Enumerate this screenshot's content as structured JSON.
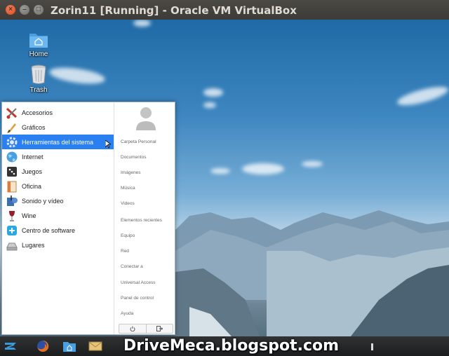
{
  "window": {
    "title": "Zorin11 [Running] - Oracle VM VirtualBox"
  },
  "desktop": {
    "icons": [
      {
        "label": "Home",
        "icon": "folder-home-icon"
      },
      {
        "label": "Trash",
        "icon": "trash-icon"
      }
    ]
  },
  "menu": {
    "categories": [
      {
        "label": "Accesorios",
        "icon": "accessories-icon"
      },
      {
        "label": "Gráficos",
        "icon": "graphics-icon"
      },
      {
        "label": "Herramientas del sistema",
        "icon": "system-tools-icon",
        "selected": true
      },
      {
        "label": "Internet",
        "icon": "internet-globe-icon"
      },
      {
        "label": "Juegos",
        "icon": "games-icon"
      },
      {
        "label": "Oficina",
        "icon": "office-icon"
      },
      {
        "label": "Sonido y vídeo",
        "icon": "multimedia-icon"
      },
      {
        "label": "Wine",
        "icon": "wine-glass-icon"
      },
      {
        "label": "Centro de software",
        "icon": "software-center-icon"
      },
      {
        "label": "Lugares",
        "icon": "places-drive-icon"
      }
    ],
    "places": [
      "Carpeta Personal",
      "Documentos",
      "Imágenes",
      "Música",
      "Videos",
      "Elementos recientes",
      "Equipo",
      "Red",
      "Conectar a",
      "Universal Access",
      "Panel de control",
      "Ayuda"
    ],
    "footer": {
      "power_icon": "power-icon",
      "logout_icon": "logout-icon"
    }
  },
  "taskbar": {
    "items": [
      "zorin-menu-icon",
      "firefox-icon",
      "files-icon",
      "mail-icon"
    ]
  },
  "watermark": "DriveMeca.blogspot.com",
  "colors": {
    "selection": "#2a7ff1",
    "title_bar": "#3c3b37",
    "close_button": "#df4a16"
  }
}
